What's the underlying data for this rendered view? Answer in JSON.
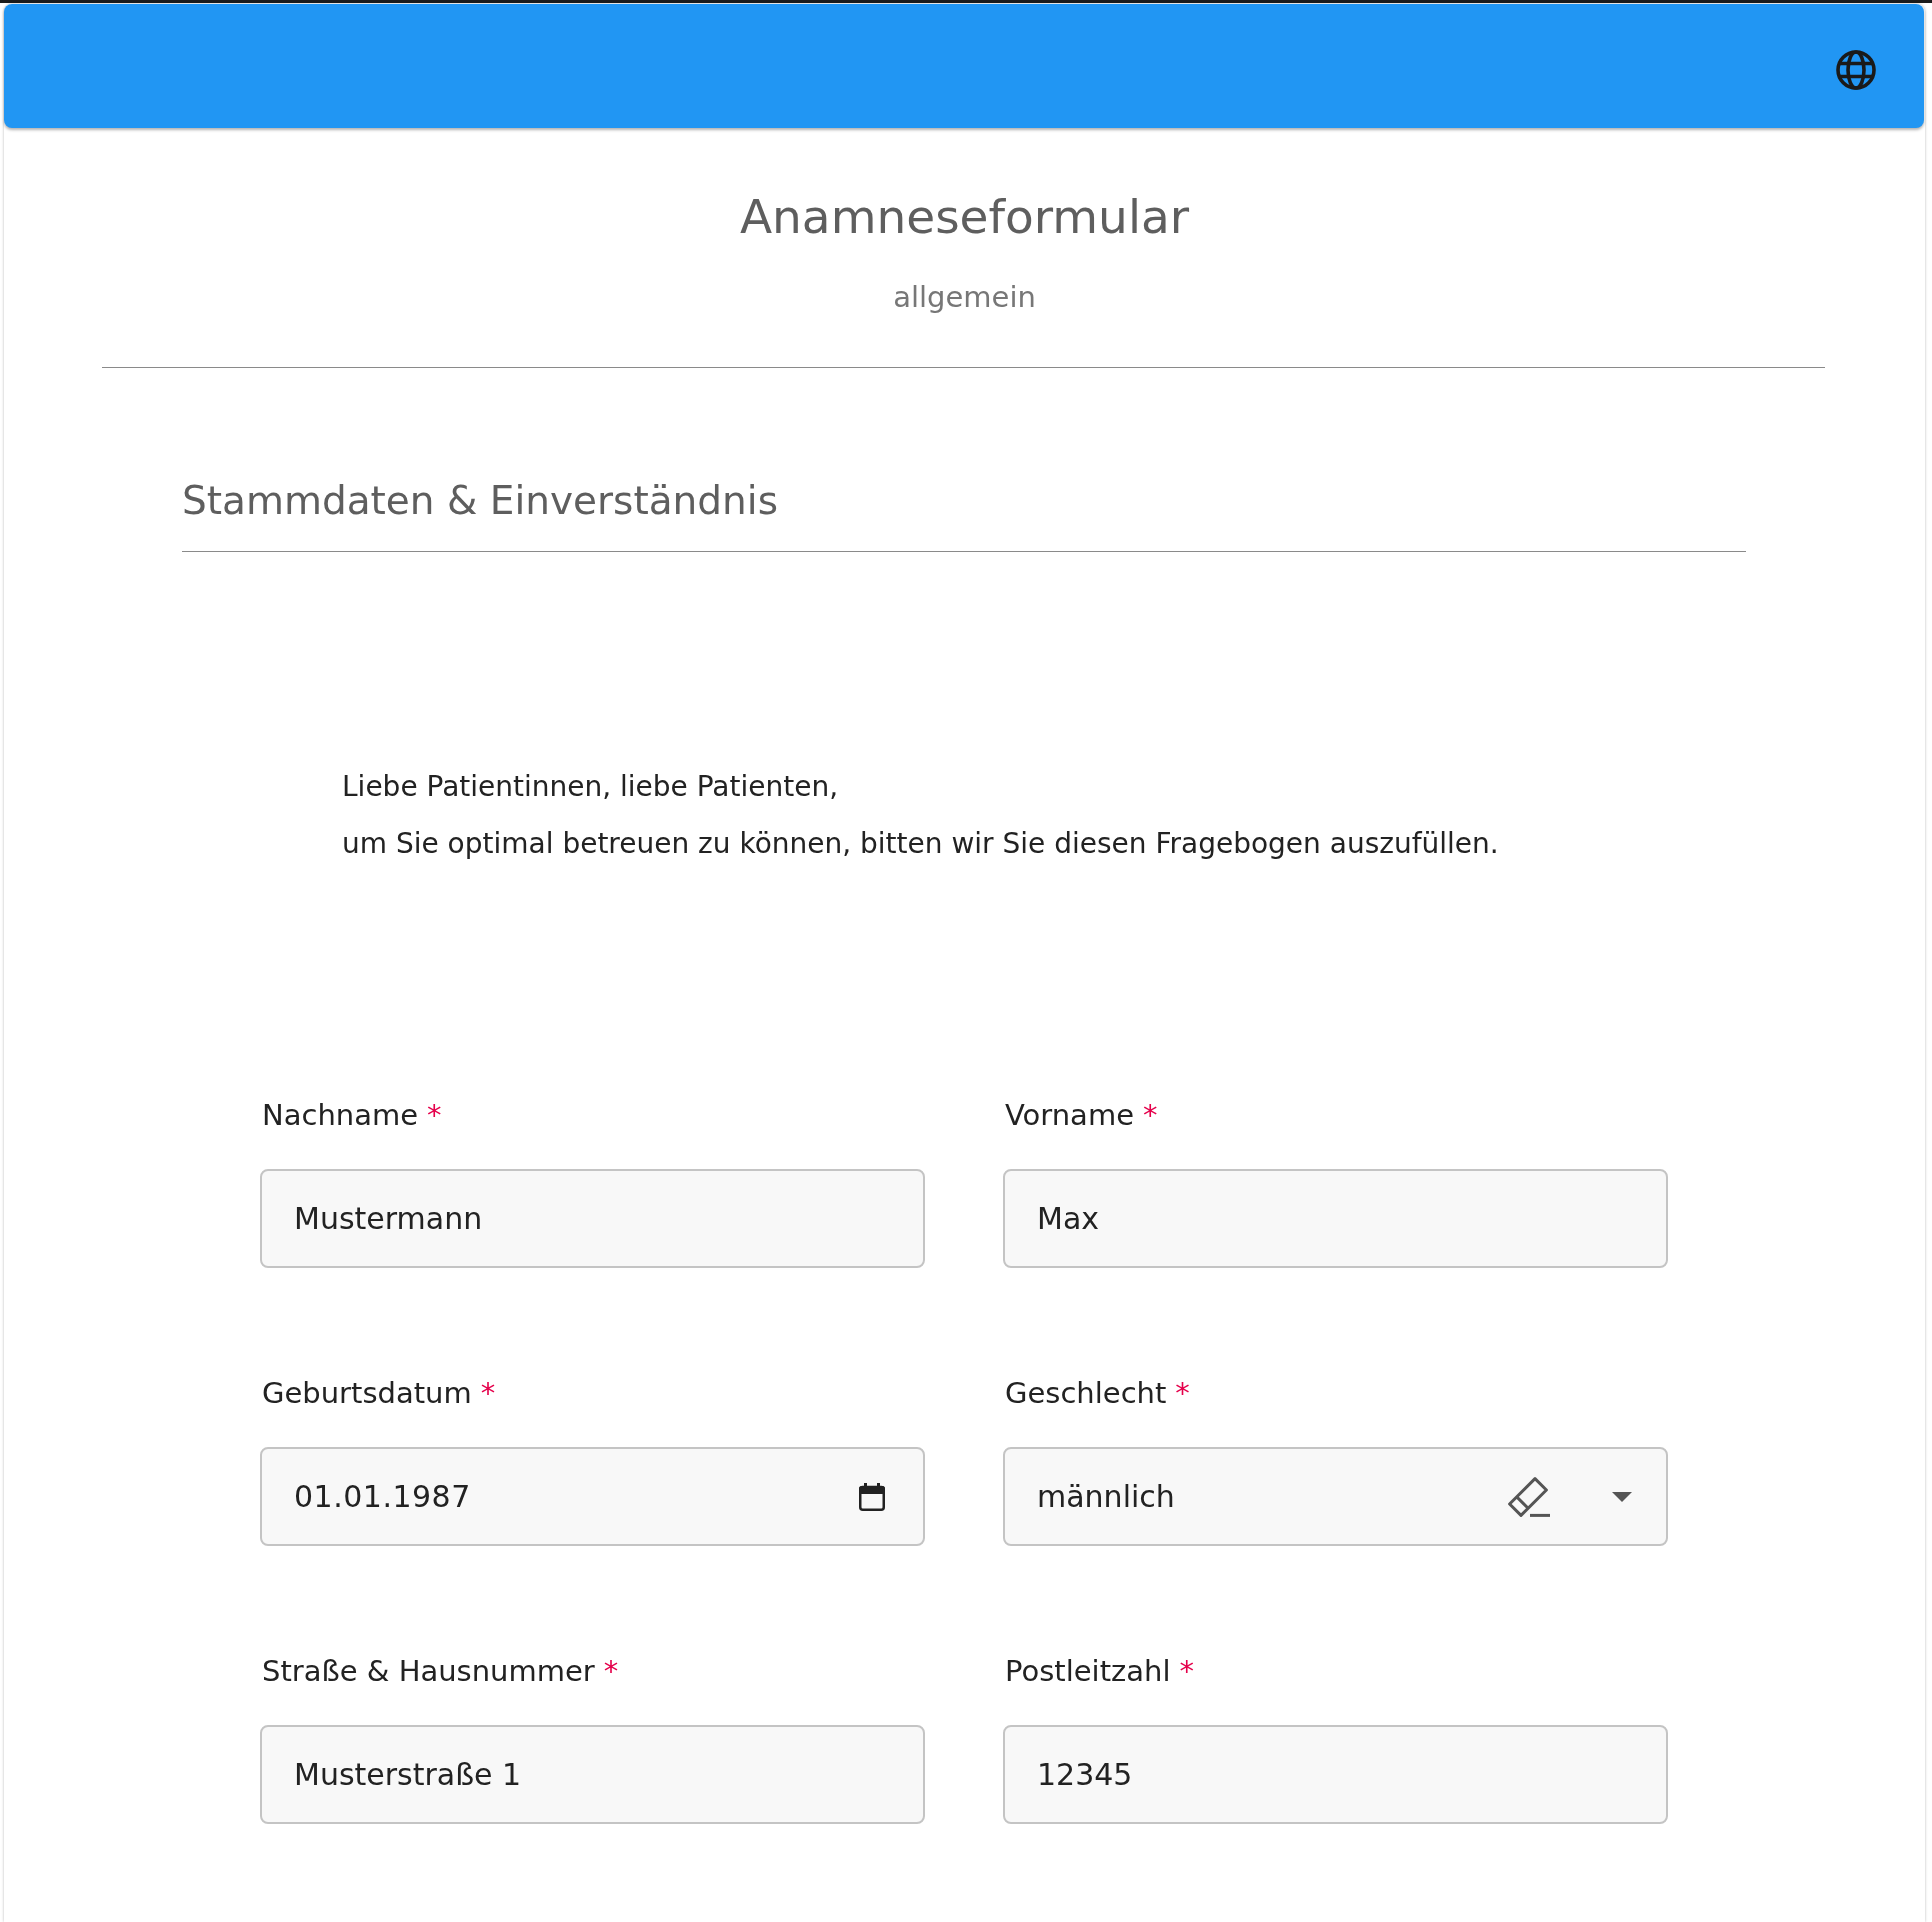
{
  "header": {
    "title": "Anamneseformular",
    "subtitle": "allgemein"
  },
  "section": {
    "title": "Stammdaten & Einverständnis",
    "greeting": "Liebe Patientinnen, liebe Patienten,",
    "intro": "um Sie optimal betreuen zu können, bitten wir Sie diesen Fragebogen auszufüllen.",
    "fields": [
      {
        "kind": "text",
        "label": "Nachname",
        "required_mark": "*",
        "value": "Mustermann"
      },
      {
        "kind": "text",
        "label": "Vorname",
        "required_mark": "*",
        "value": "Max"
      },
      {
        "kind": "date",
        "label": "Geburtsdatum",
        "required_mark": "*",
        "value": "01.01.1987"
      },
      {
        "kind": "select",
        "label": "Geschlecht",
        "required_mark": "*",
        "value": "männlich"
      },
      {
        "kind": "text",
        "label": "Straße & Hausnummer",
        "required_mark": "*",
        "value": "Musterstraße 1"
      },
      {
        "kind": "text",
        "label": "Postleitzahl",
        "required_mark": "*",
        "value": "12345"
      }
    ]
  }
}
